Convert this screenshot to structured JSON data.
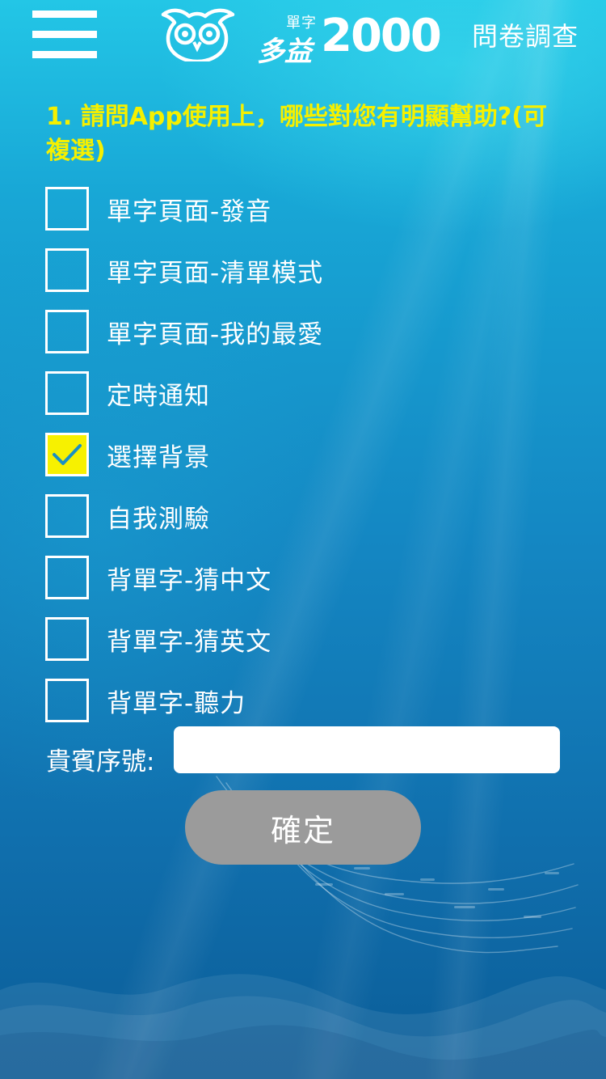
{
  "header": {
    "title": "問卷調查",
    "logo": {
      "small_text": "單字",
      "main_text": "多益",
      "number": "2000"
    }
  },
  "question": {
    "text": "1. 請問App使用上，哪些對您有明顯幫助?(可複選)",
    "options": [
      {
        "label": "單字頁面-發音",
        "checked": false
      },
      {
        "label": "單字頁面-清單模式",
        "checked": false
      },
      {
        "label": "單字頁面-我的最愛",
        "checked": false
      },
      {
        "label": "定時通知",
        "checked": false
      },
      {
        "label": "選擇背景",
        "checked": true
      },
      {
        "label": "自我測驗",
        "checked": false
      },
      {
        "label": "背單字-猜中文",
        "checked": false
      },
      {
        "label": "背單字-猜英文",
        "checked": false
      },
      {
        "label": "背單字-聽力",
        "checked": false
      }
    ]
  },
  "member": {
    "label": "貴賓序號:",
    "value": "",
    "placeholder": ""
  },
  "confirm": {
    "label": "確定"
  },
  "colors": {
    "accent_yellow": "#f5f000",
    "checkbox_checked": "#f7f100",
    "check_mark": "#1a8fc4",
    "confirm_button": "#9b9b9b"
  },
  "icons": {
    "menu": "menu-icon",
    "logo": "owl-icon",
    "check": "check-icon"
  }
}
